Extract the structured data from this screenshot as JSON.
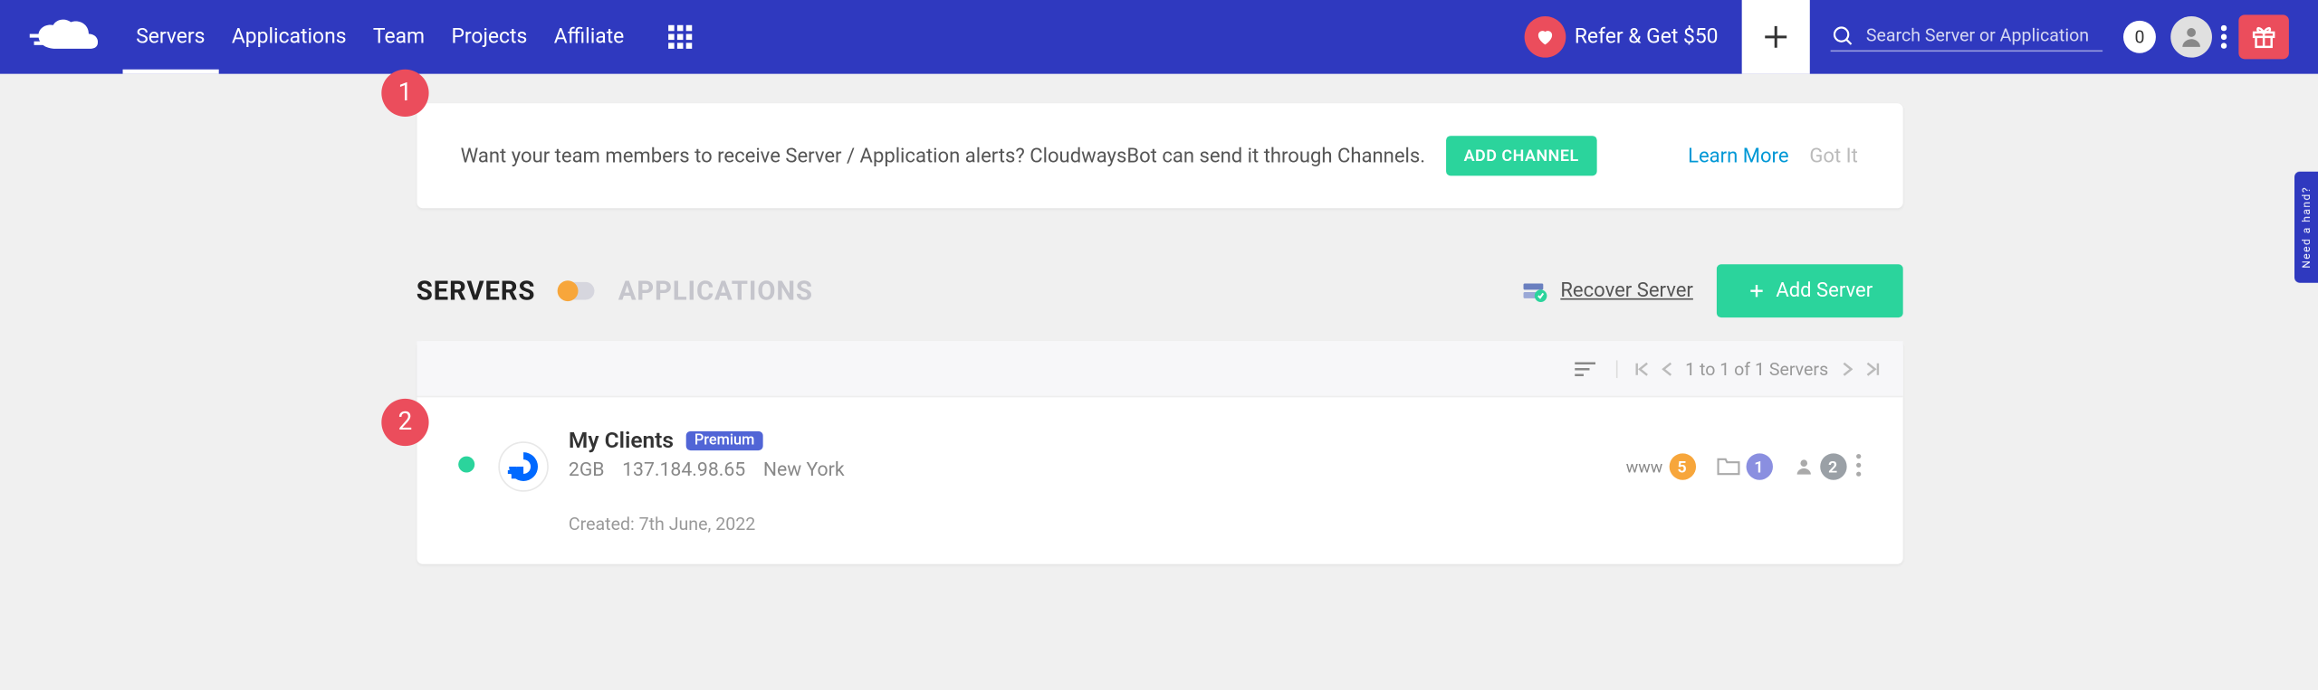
{
  "nav": {
    "links": [
      "Servers",
      "Applications",
      "Team",
      "Projects",
      "Affiliate"
    ],
    "refer_label": "Refer & Get $50",
    "search_placeholder": "Search Server or Application",
    "badge": "0"
  },
  "alert": {
    "text": "Want your team members to receive Server / Application alerts? CloudwaysBot can send it through Channels.",
    "button": "ADD CHANNEL",
    "learn_more": "Learn More",
    "got_it": "Got It"
  },
  "tabs": {
    "servers": "SERVERS",
    "applications": "APPLICATIONS",
    "recover": "Recover Server",
    "add_server": "Add Server"
  },
  "pager": {
    "text": "1 to 1 of 1 Servers"
  },
  "server": {
    "name": "My Clients",
    "badge": "Premium",
    "size": "2GB",
    "ip": "137.184.98.65",
    "region": "New York",
    "created": "Created: 7th June, 2022",
    "www_label": "www",
    "www_count": "5",
    "projects_count": "1",
    "users_count": "2"
  },
  "callouts": {
    "one": "1",
    "two": "2"
  },
  "help": "Need a hand?"
}
